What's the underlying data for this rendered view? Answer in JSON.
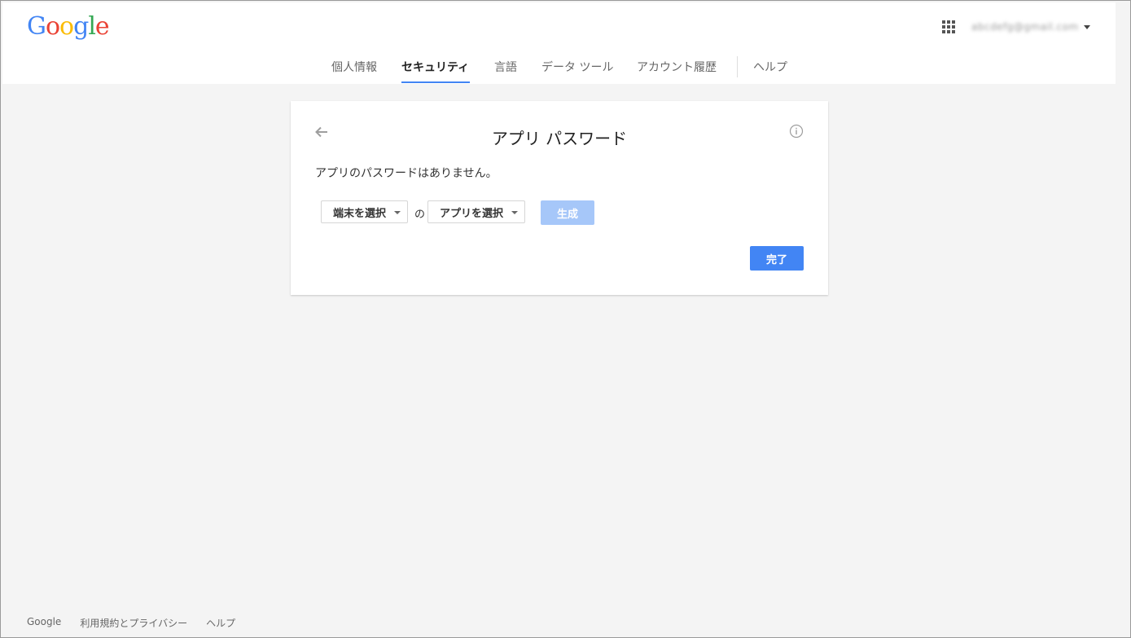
{
  "header": {
    "logo_letters": [
      {
        "ch": "G",
        "color": "#4285f4"
      },
      {
        "ch": "o",
        "color": "#ea4335"
      },
      {
        "ch": "o",
        "color": "#fbbc05"
      },
      {
        "ch": "g",
        "color": "#4285f4"
      },
      {
        "ch": "l",
        "color": "#34a853"
      },
      {
        "ch": "e",
        "color": "#ea4335"
      }
    ],
    "account_email": "abcdefg@gmail.com",
    "apps_icon": "grid-apps-icon",
    "account_menu_icon": "caret-down-icon"
  },
  "tabs": [
    {
      "label": "個人情報",
      "active": false
    },
    {
      "label": "セキュリティ",
      "active": true
    },
    {
      "label": "言語",
      "active": false
    },
    {
      "label": "データ ツール",
      "active": false
    },
    {
      "label": "アカウント履歴",
      "active": false
    },
    {
      "label": "ヘルプ",
      "active": false
    }
  ],
  "card": {
    "title": "アプリ パスワード",
    "empty_message": "アプリのパスワードはありません。",
    "device_select": "端末を選択",
    "connector": "の",
    "app_select": "アプリを選択",
    "generate_label": "生成",
    "done_label": "完了",
    "back_icon": "arrow-left-icon",
    "info_icon": "info-icon"
  },
  "footer": {
    "links": [
      "Google",
      "利用規約とプライバシー",
      "ヘルプ"
    ]
  },
  "colors": {
    "accent": "#4285f4",
    "accent_disabled": "#a6c7f9",
    "background": "#f4f4f4"
  }
}
